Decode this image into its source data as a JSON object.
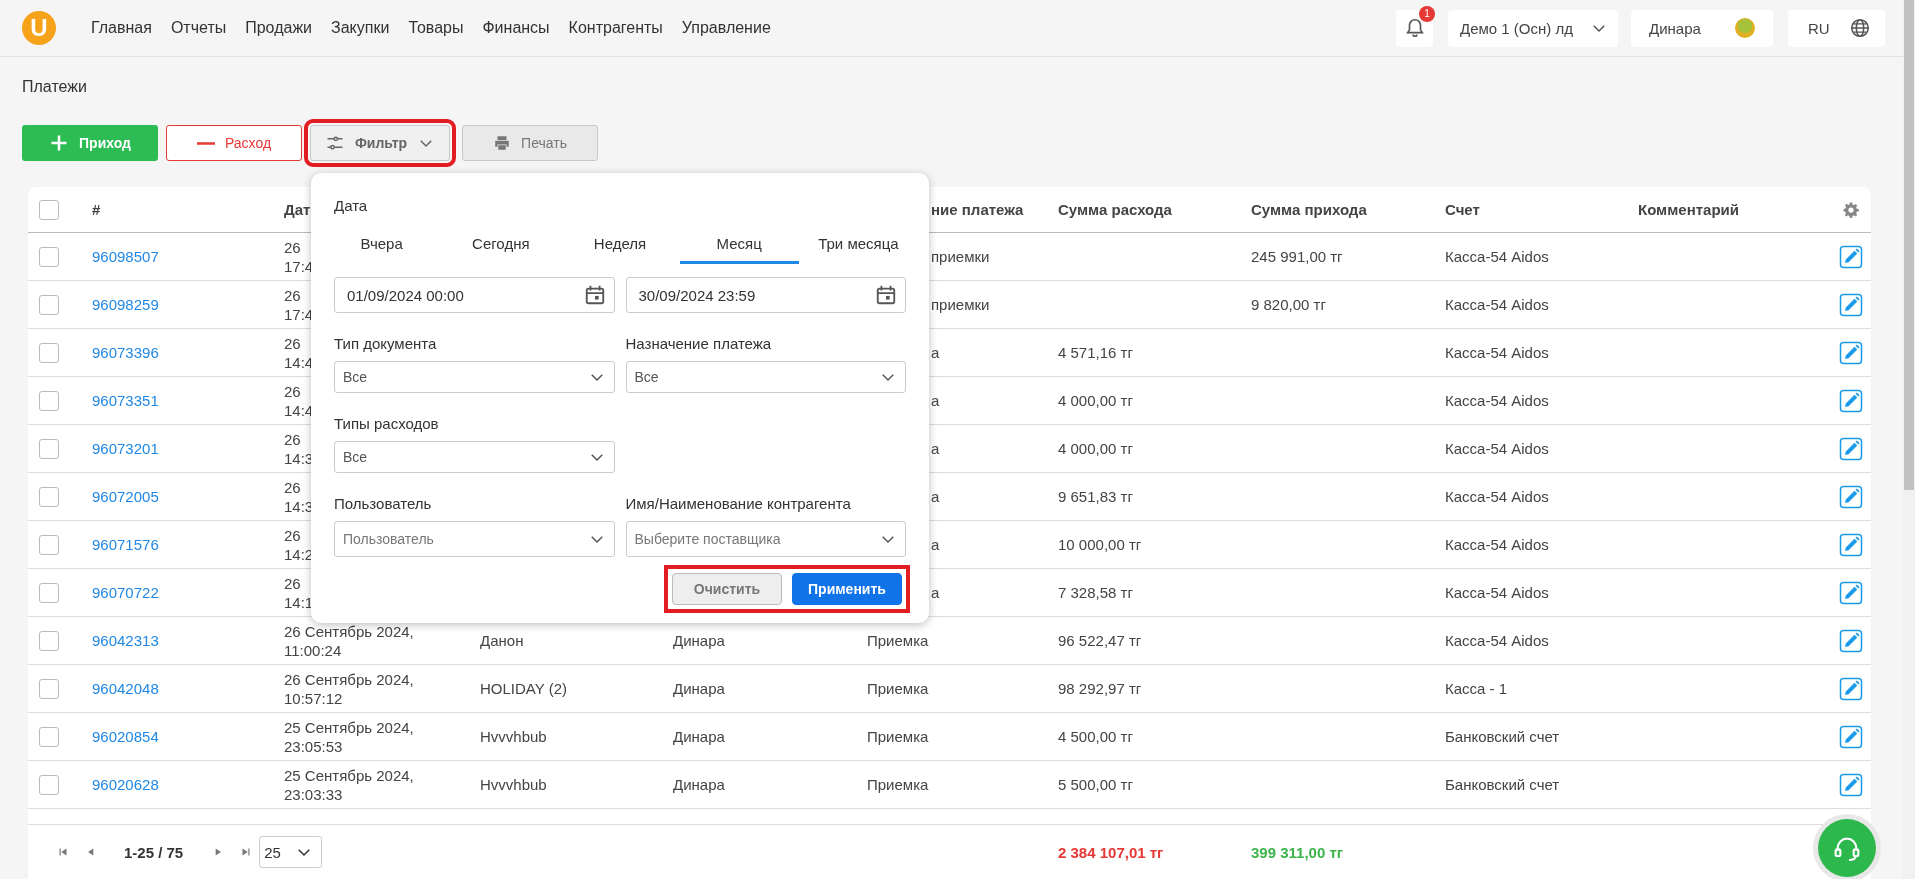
{
  "topbar": {
    "logo": "U",
    "nav": [
      {
        "label": "Главная"
      },
      {
        "label": "Отчеты"
      },
      {
        "label": "Продажи"
      },
      {
        "label": "Закупки"
      },
      {
        "label": "Товары"
      },
      {
        "label": "Финансы"
      },
      {
        "label": "Контрагенты"
      },
      {
        "label": "Управление"
      }
    ],
    "notifications": "1",
    "company": "Демо 1 (Осн) лд",
    "user": "Динара",
    "language": "RU"
  },
  "page_title": "Платежи",
  "actions": [
    {
      "kind": "income",
      "label": "Приход",
      "highlighted": false
    },
    {
      "kind": "expense",
      "label": "Расход",
      "highlighted": false
    },
    {
      "kind": "filter",
      "label": "Фильтр",
      "highlighted": true
    },
    {
      "kind": "print",
      "label": "Печать",
      "highlighted": false
    }
  ],
  "table": {
    "all_selected": false,
    "columns": {
      "number": "#",
      "date": "Дат",
      "purpose": "ние платежа",
      "expense": "Сумма расхода",
      "income": "Сумма прихода",
      "account": "Счет",
      "comment": "Комментарий"
    },
    "rows": [
      {
        "selected": false,
        "number": "96098507",
        "date": [
          "26",
          "17:4"
        ],
        "purpose": "приемки",
        "income": "245 991,00 тг",
        "account": "Касса-54 Aidos"
      },
      {
        "selected": false,
        "number": "96098259",
        "date": [
          "26",
          "17:4"
        ],
        "purpose": "приемки",
        "income": "9 820,00 тг",
        "account": "Касса-54 Aidos"
      },
      {
        "selected": false,
        "number": "96073396",
        "date": [
          "26",
          "14:4"
        ],
        "purpose": "а",
        "expense": "4 571,16 тг",
        "account": "Касса-54 Aidos"
      },
      {
        "selected": false,
        "number": "96073351",
        "date": [
          "26",
          "14:4"
        ],
        "purpose": "а",
        "expense": "4 000,00 тг",
        "account": "Касса-54 Aidos"
      },
      {
        "selected": false,
        "number": "96073201",
        "date": [
          "26",
          "14:3"
        ],
        "purpose": "а",
        "expense": "4 000,00 тг",
        "account": "Касса-54 Aidos"
      },
      {
        "selected": false,
        "number": "96072005",
        "date": [
          "26",
          "14:3"
        ],
        "purpose": "а",
        "expense": "9 651,83 тг",
        "account": "Касса-54 Aidos"
      },
      {
        "selected": false,
        "number": "96071576",
        "date": [
          "26",
          "14:2"
        ],
        "purpose": "а",
        "expense": "10 000,00 тг",
        "account": "Касса-54 Aidos"
      },
      {
        "selected": false,
        "number": "96070722",
        "date": [
          "26",
          "14:1"
        ],
        "purpose": "а",
        "expense": "7 328,58 тг",
        "account": "Касса-54 Aidos"
      },
      {
        "selected": false,
        "number": "96042313",
        "date": [
          "26 Сентябрь 2024,",
          "11:00:24"
        ],
        "counterparty": "Данон",
        "user": "Динара",
        "purpose": "Приемка",
        "expense": "96 522,47 тг",
        "account": "Касса-54 Aidos"
      },
      {
        "selected": false,
        "number": "96042048",
        "date": [
          "26 Сентябрь 2024,",
          "10:57:12"
        ],
        "counterparty": "HOLIDAY (2)",
        "user": "Динара",
        "purpose": "Приемка",
        "expense": "98 292,97 тг",
        "account": "Касса - 1"
      },
      {
        "selected": false,
        "number": "96020854",
        "date": [
          "25 Сентябрь 2024,",
          "23:05:53"
        ],
        "counterparty": "Hvvvhbub",
        "user": "Динара",
        "purpose": "Приемка",
        "expense": "4 500,00 тг",
        "account": "Банковский счет"
      },
      {
        "selected": false,
        "number": "96020628",
        "date": [
          "25 Сентябрь 2024,",
          "23:03:33"
        ],
        "counterparty": "Hvvvhbub",
        "user": "Динара",
        "purpose": "Приемка",
        "expense": "5 500,00 тг",
        "account": "Банковский счет"
      }
    ],
    "footer": {
      "range": "1-25 / 75",
      "page_size": "25",
      "total_expense": "2 384 107,01 тг",
      "total_income": "399 311,00 тг"
    }
  },
  "filter": {
    "title": "Дата",
    "periods": [
      {
        "label": "Вчера",
        "selected": false
      },
      {
        "label": "Сегодня",
        "selected": false
      },
      {
        "label": "Неделя",
        "selected": false
      },
      {
        "label": "Месяц",
        "selected": true
      },
      {
        "label": "Три месяца",
        "selected": false
      }
    ],
    "date_from": "01/09/2024 00:00",
    "date_to": "30/09/2024 23:59",
    "field_rows": [
      [
        {
          "label": "Тип документа",
          "value": "Все"
        },
        {
          "label": "Назначение платежа",
          "value": "Все"
        }
      ],
      [
        {
          "label": "Типы расходов",
          "value": "Все"
        }
      ],
      [
        {
          "label": "Пользователь",
          "placeholder": "Пользователь"
        },
        {
          "label": "Имя/Наименование контрагента",
          "placeholder": "Выберите поставщика"
        }
      ]
    ],
    "buttons": [
      {
        "kind": "clear",
        "label": "Очистить"
      },
      {
        "kind": "apply",
        "label": "Применить"
      }
    ],
    "buttons_highlighted": true
  }
}
